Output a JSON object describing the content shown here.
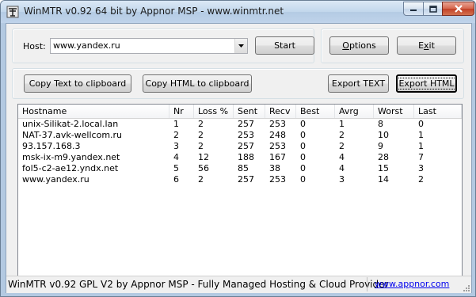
{
  "window": {
    "title": "WinMTR v0.92 64 bit by Appnor MSP - www.winmtr.net"
  },
  "host": {
    "label": "Host:",
    "value": "www.yandex.ru"
  },
  "buttons": {
    "start": "Start",
    "options": "Options",
    "options_accel": "O",
    "exit": "Exit",
    "exit_accel": "x",
    "copy_text": "Copy Text to clipboard",
    "copy_html": "Copy HTML to clipboard",
    "export_text": "Export TEXT",
    "export_html": "Export HTML"
  },
  "table": {
    "columns": [
      "Hostname",
      "Nr",
      "Loss %",
      "Sent",
      "Recv",
      "Best",
      "Avrg",
      "Worst",
      "Last"
    ],
    "rows": [
      [
        "unix-Silikat-2.local.lan",
        "1",
        "2",
        "257",
        "253",
        "0",
        "1",
        "8",
        "0"
      ],
      [
        "NAT-37.avk-wellcom.ru",
        "2",
        "2",
        "253",
        "248",
        "0",
        "2",
        "10",
        "1"
      ],
      [
        "93.157.168.3",
        "3",
        "2",
        "257",
        "253",
        "0",
        "2",
        "9",
        "1"
      ],
      [
        "msk-ix-m9.yandex.net",
        "4",
        "12",
        "188",
        "167",
        "0",
        "4",
        "28",
        "7"
      ],
      [
        "fol5-c2-ae12.yndx.net",
        "5",
        "56",
        "85",
        "38",
        "0",
        "4",
        "15",
        "3"
      ],
      [
        "www.yandex.ru",
        "6",
        "2",
        "257",
        "253",
        "0",
        "3",
        "14",
        "2"
      ]
    ]
  },
  "status": {
    "text": "WinMTR v0.92 GPL V2 by Appnor MSP - Fully Managed Hosting & Cloud Provider",
    "link": "www.appnor.com"
  }
}
